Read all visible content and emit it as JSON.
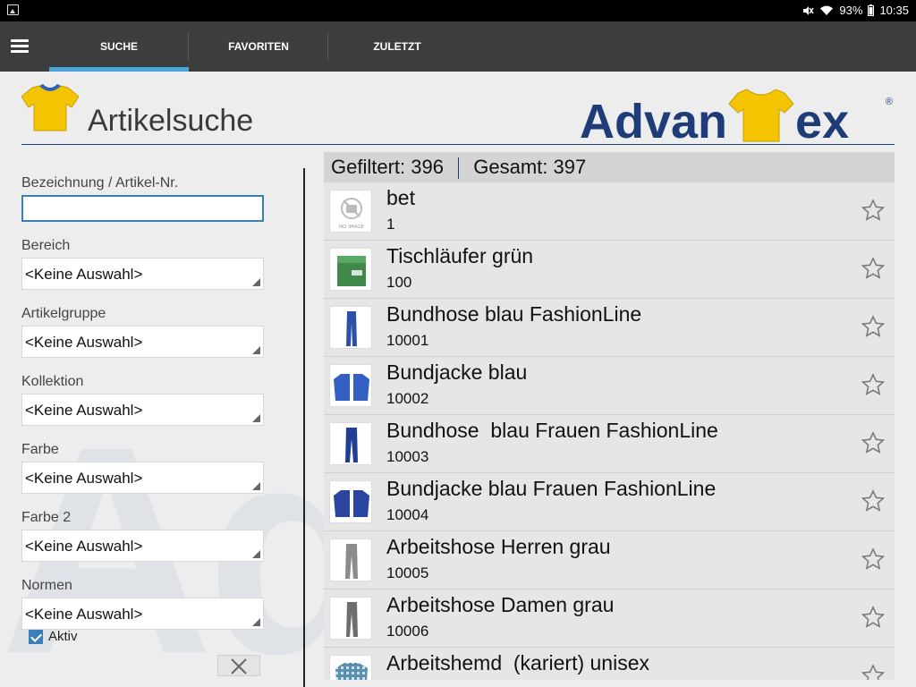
{
  "status_bar": {
    "battery": "93%",
    "time": "10:35"
  },
  "tabs": [
    {
      "label": "SUCHE",
      "active": true
    },
    {
      "label": "FAVORITEN",
      "active": false
    },
    {
      "label": "ZULETZT",
      "active": false
    }
  ],
  "header": {
    "title": "Artikelsuche",
    "brand_prefix": "Advan",
    "brand_suffix": "ex",
    "brand_reg": "®"
  },
  "watermark": "Advan",
  "filters": {
    "search": {
      "label": "Bezeichnung / Artikel-Nr.",
      "value": ""
    },
    "selects": [
      {
        "label": "Bereich",
        "value": "<Keine Auswahl>"
      },
      {
        "label": "Artikelgruppe",
        "value": "<Keine Auswahl>"
      },
      {
        "label": "Kollektion",
        "value": "<Keine Auswahl>"
      },
      {
        "label": "Farbe",
        "value": "<Keine Auswahl>"
      },
      {
        "label": "Farbe 2",
        "value": "<Keine Auswahl>"
      },
      {
        "label": "Normen",
        "value": "<Keine Auswahl>"
      }
    ],
    "active_checkbox": {
      "label": "Aktiv",
      "checked": true
    }
  },
  "results": {
    "filtered_label": "Gefiltert:",
    "filtered_value": "396",
    "total_label": "Gesamt:",
    "total_value": "397",
    "items": [
      {
        "name": "bet",
        "number": "1",
        "thumb": "no-image"
      },
      {
        "name": "Tischläufer grün",
        "number": "100",
        "thumb": "green-box"
      },
      {
        "name": "Bundhose blau FashionLine",
        "number": "10001",
        "thumb": "blue-pants"
      },
      {
        "name": "Bundjacke blau",
        "number": "10002",
        "thumb": "blue-jacket"
      },
      {
        "name": "Bundhose  blau Frauen FashionLine",
        "number": "10003",
        "thumb": "blue-pants"
      },
      {
        "name": "Bundjacke blau Frauen FashionLine",
        "number": "10004",
        "thumb": "blue-jacket"
      },
      {
        "name": "Arbeitshose Herren grau",
        "number": "10005",
        "thumb": "grey-pants"
      },
      {
        "name": "Arbeitshose Damen grau",
        "number": "10006",
        "thumb": "grey-pants"
      },
      {
        "name": "Arbeitshemd  (kariert) unisex",
        "number": "",
        "thumb": "checked-shirt"
      }
    ]
  },
  "colors": {
    "accent": "#4aa6d8",
    "brand": "#1d3c78",
    "appbar": "#3d3d3d"
  }
}
